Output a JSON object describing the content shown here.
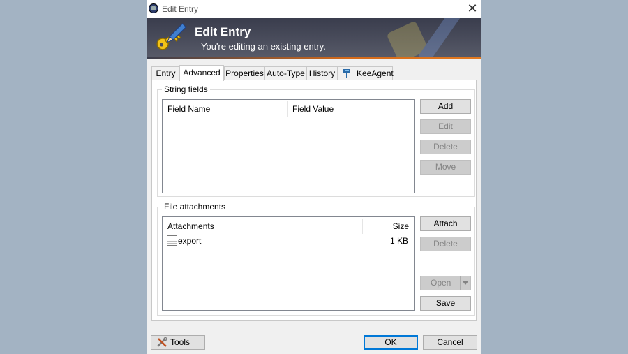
{
  "window": {
    "title": "Edit Entry",
    "close_glyph": "✕"
  },
  "banner": {
    "title": "Edit Entry",
    "subtitle": "You're editing an existing entry."
  },
  "tabs": [
    {
      "label": "Entry",
      "active": false
    },
    {
      "label": "Advanced",
      "active": true
    },
    {
      "label": "Properties",
      "active": false
    },
    {
      "label": "Auto-Type",
      "active": false
    },
    {
      "label": "History",
      "active": false
    },
    {
      "label": "KeeAgent",
      "active": false
    }
  ],
  "string_fields": {
    "label": "String fields",
    "columns": [
      "Field Name",
      "Field Value"
    ],
    "buttons": {
      "add": "Add",
      "edit": "Edit",
      "delete": "Delete",
      "move": "Move"
    }
  },
  "file_attachments": {
    "label": "File attachments",
    "columns": [
      "Attachments",
      "Size"
    ],
    "rows": [
      {
        "name": "export",
        "size": "1 KB"
      }
    ],
    "buttons": {
      "attach": "Attach",
      "delete": "Delete",
      "open": "Open",
      "save": "Save"
    }
  },
  "footer": {
    "tools": "Tools",
    "ok": "OK",
    "cancel": "Cancel"
  },
  "icons": {
    "title": "lock-icon",
    "banner": "key-pencil-icon",
    "keeagent": "keeagent-icon",
    "file": "file-icon",
    "tools": "tools-icon"
  },
  "colors": {
    "accent": "#0078d7",
    "banner_dark": "#3a3d4d",
    "banner_orange": "#e27a20"
  }
}
